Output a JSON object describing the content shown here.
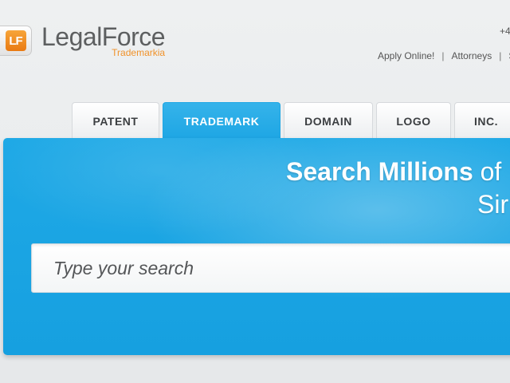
{
  "header": {
    "logo": {
      "badge_text": "LF",
      "name": "LegalForce",
      "sub": "Trademarkia"
    },
    "phone": "+4",
    "links": [
      {
        "label": "Apply Online!"
      },
      {
        "label": "Attorneys"
      },
      {
        "label": "S"
      }
    ],
    "separator": "|"
  },
  "tabs": [
    {
      "label": "PATENT",
      "active": false
    },
    {
      "label": "TRADEMARK",
      "active": true
    },
    {
      "label": "DOMAIN",
      "active": false
    },
    {
      "label": "LOGO",
      "active": false
    },
    {
      "label": "INC.",
      "active": false
    }
  ],
  "hero": {
    "headline_bold": "Search Millions",
    "headline_rest": " of",
    "subline": "Sir",
    "search": {
      "placeholder": "Type your search",
      "value": ""
    }
  },
  "colors": {
    "accent_blue": "#1fa9e6",
    "logo_orange": "#f0922a",
    "text_gray": "#5d5f60"
  }
}
